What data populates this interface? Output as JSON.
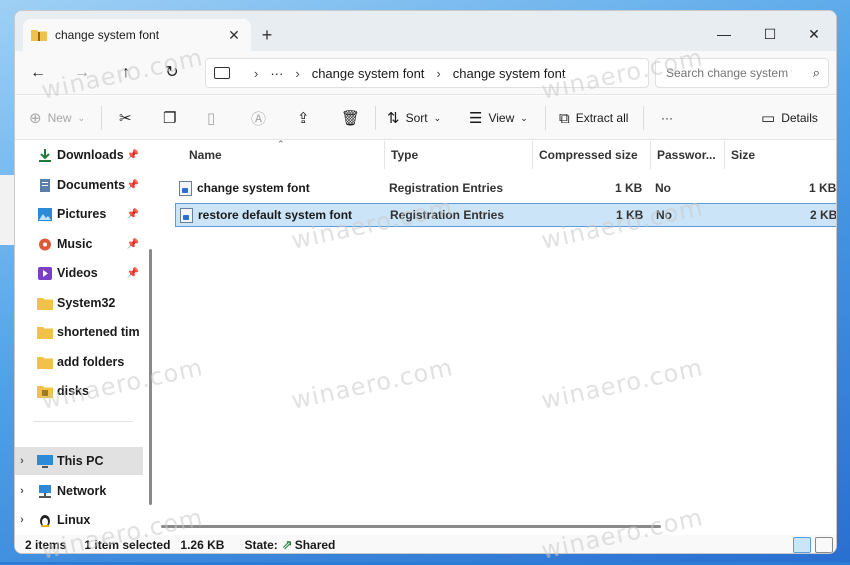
{
  "tab": {
    "title": "change system font",
    "close": "✕",
    "new": "+"
  },
  "window_controls": {
    "minimize": "—",
    "maximize": "☐",
    "close": "✕"
  },
  "nav": {
    "back": "←",
    "forward": "→",
    "up": "↑",
    "refresh": "↻"
  },
  "address": {
    "more": "···",
    "crumbs": [
      "change system font",
      "change system font"
    ]
  },
  "search": {
    "placeholder": "Search change system font"
  },
  "toolbar": {
    "new_label": "New",
    "sort_label": "Sort",
    "view_label": "View",
    "extract_label": "Extract all",
    "more_label": "···",
    "details_label": "Details"
  },
  "sidebar": {
    "quick": [
      {
        "label": "Downloads",
        "icon": "download-icon",
        "pinned": true
      },
      {
        "label": "Documents",
        "icon": "documents-icon",
        "pinned": true
      },
      {
        "label": "Pictures",
        "icon": "pictures-icon",
        "pinned": true
      },
      {
        "label": "Music",
        "icon": "music-icon",
        "pinned": true
      },
      {
        "label": "Videos",
        "icon": "videos-icon",
        "pinned": true
      },
      {
        "label": "System32",
        "icon": "folder-icon",
        "pinned": false
      },
      {
        "label": "shortened tim",
        "icon": "folder-icon",
        "pinned": false
      },
      {
        "label": "add folders",
        "icon": "folder-icon",
        "pinned": false
      },
      {
        "label": "disks",
        "icon": "folder-icon",
        "pinned": false
      }
    ],
    "roots": [
      {
        "label": "This PC",
        "icon": "pc-icon",
        "selected": true
      },
      {
        "label": "Network",
        "icon": "network-icon",
        "selected": false
      },
      {
        "label": "Linux",
        "icon": "linux-icon",
        "selected": false
      }
    ]
  },
  "columns": [
    "Name",
    "Type",
    "Compressed size",
    "Passwor...",
    "Size"
  ],
  "files": [
    {
      "name": "change system font",
      "type": "Registration Entries",
      "compressed": "1 KB",
      "password": "No",
      "size": "1 KB",
      "selected": false
    },
    {
      "name": "restore default system font",
      "type": "Registration Entries",
      "compressed": "1 KB",
      "password": "No",
      "size": "2 KB",
      "selected": true
    }
  ],
  "status": {
    "items": "2 items",
    "selected": "1 item selected",
    "sel_size": "1.26 KB",
    "state_label": "State:",
    "state_value": "Shared"
  },
  "watermark": "winaero.com",
  "colors": {
    "accent": "#0067c0",
    "selection": "#cce4f7",
    "folder": "#f0c24a"
  }
}
